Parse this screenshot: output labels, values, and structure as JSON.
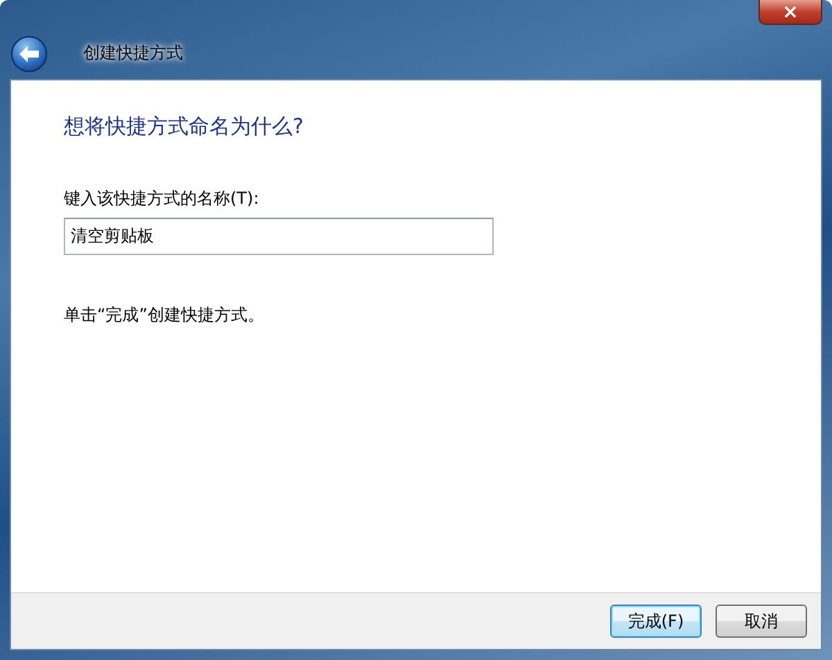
{
  "window": {
    "title": "创建快捷方式",
    "close": "×"
  },
  "heading": "想将快捷方式命名为什么?",
  "name_field": {
    "label": "键入该快捷方式的名称(T):",
    "value": "清空剪贴板"
  },
  "hint": "单击“完成”创建快捷方式。",
  "buttons": [
    {
      "label": "完成(F)",
      "default": true
    },
    {
      "label": "取消",
      "default": false
    }
  ]
}
